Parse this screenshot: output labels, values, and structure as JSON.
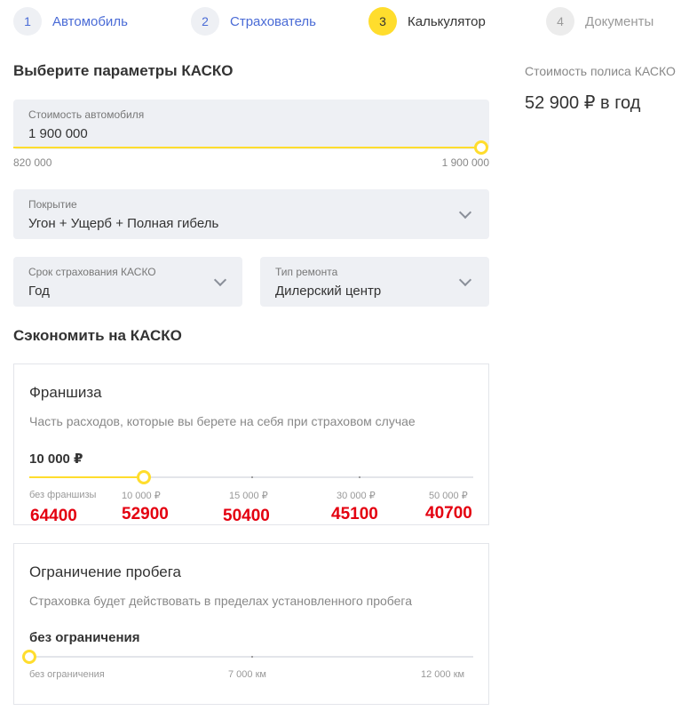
{
  "stepper": {
    "steps": [
      {
        "num": "1",
        "label": "Автомобиль"
      },
      {
        "num": "2",
        "label": "Страхователь"
      },
      {
        "num": "3",
        "label": "Калькулятор"
      },
      {
        "num": "4",
        "label": "Документы"
      }
    ],
    "active_step": 3
  },
  "main": {
    "title": "Выберите параметры КАСКО",
    "car_value": {
      "label": "Стоимость автомобиля",
      "value": "1 900 000",
      "min_label": "820 000",
      "max_label": "1 900 000",
      "slider_fraction": 1.0
    },
    "coverage": {
      "label": "Покрытие",
      "value": "Угон + Ущерб + Полная гибель"
    },
    "term": {
      "label": "Срок страхования КАСКО",
      "value": "Год"
    },
    "repair": {
      "label": "Тип ремонта",
      "value": "Дилерский центр"
    },
    "save_title": "Сэкономить на КАСКО",
    "franchise": {
      "title": "Франшиза",
      "description": "Часть расходов, которые вы берете на себя при страховом случае",
      "selected": "10 000 ₽",
      "selected_index": 1,
      "options": [
        {
          "label": "без франшизы",
          "price": "64400"
        },
        {
          "label": "10 000 ₽",
          "price": "52900"
        },
        {
          "label": "15 000 ₽",
          "price": "50400"
        },
        {
          "label": "30 000 ₽",
          "price": "45100"
        },
        {
          "label": "50 000 ₽",
          "price": "40700"
        }
      ]
    },
    "mileage": {
      "title": "Ограничение пробега",
      "description": "Страховка будет действовать в пределах установленного пробега",
      "selected": "без ограничения",
      "selected_index": 0,
      "options": [
        "без ограничения",
        "7 000 км",
        "12 000 км"
      ]
    }
  },
  "sidebar": {
    "label": "Стоимость полиса КАСКО",
    "value": "52 900 ₽ в год"
  },
  "colors": {
    "accent": "#ffdd2d",
    "link": "#4a6bd6",
    "field_bg": "#eef0f4",
    "price_annotation": "#e40010"
  }
}
